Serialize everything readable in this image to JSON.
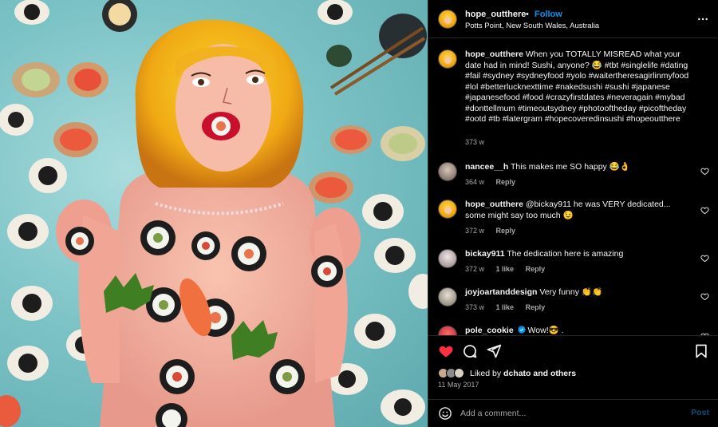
{
  "post": {
    "username": "hope_outthere",
    "follow_label": "Follow",
    "separator": "•",
    "location": "Potts Point, New South Wales, Australia"
  },
  "caption": {
    "username": "hope_outthere",
    "text": "When you TOTALLY MISREAD what your date had in mind! Sushi, anyone? 😂 #tbt #singlelife #dating #fail #sydney #sydneyfood #yolo #waitertheresagirlinmyfood #lol #betterlucknexttime #nakedsushi #sushi #japanese #japanesefood #food #crazyfirstdates #neveragain #mybad #donttellmum #timeoutsydney #photooftheday #picoftheday #ootd #tb #latergram #hopecoveredinsushi #hopeoutthere",
    "time": "373 w"
  },
  "comments": [
    {
      "username": "nancee__h",
      "text": "This makes me SO happy 😂👌",
      "time": "364 w",
      "likes": "",
      "reply": "Reply",
      "avatar": "nancee"
    },
    {
      "username": "hope_outthere",
      "text": "@bickay911 he was VERY dedicated... some might say too much 😉",
      "time": "372 w",
      "likes": "",
      "reply": "Reply",
      "avatar": "hope"
    },
    {
      "username": "bickay911",
      "text": "The dedication here is amazing",
      "time": "372 w",
      "likes": "1 like",
      "reply": "Reply",
      "avatar": "bicky"
    },
    {
      "username": "joyjoartanddesign",
      "text": "Very funny 👏👏",
      "time": "373 w",
      "likes": "1 like",
      "reply": "Reply",
      "avatar": "joy"
    },
    {
      "username": "pole_cookie",
      "text": "Wow!😎 .",
      "time": "",
      "likes": "",
      "reply": "",
      "avatar": "pole",
      "verified": true
    }
  ],
  "engagement": {
    "liked_by_prefix": "Liked by",
    "liked_by_user": "dchato",
    "and_others": "and others",
    "date": "11 May 2017"
  },
  "add_comment": {
    "placeholder": "Add a comment...",
    "post_label": "Post"
  },
  "icons": {
    "more": "more-horizontal-icon",
    "like": "heart-filled-icon",
    "comment": "comment-icon",
    "share": "send-icon",
    "save": "bookmark-icon",
    "emoji": "emoji-icon",
    "comment_like": "heart-outline-icon",
    "verified": "verified-badge-icon"
  },
  "colors": {
    "link": "#0095f6",
    "like": "#ff3040",
    "muted": "#a8a8a8",
    "post_disabled": "#0a4f7a"
  }
}
